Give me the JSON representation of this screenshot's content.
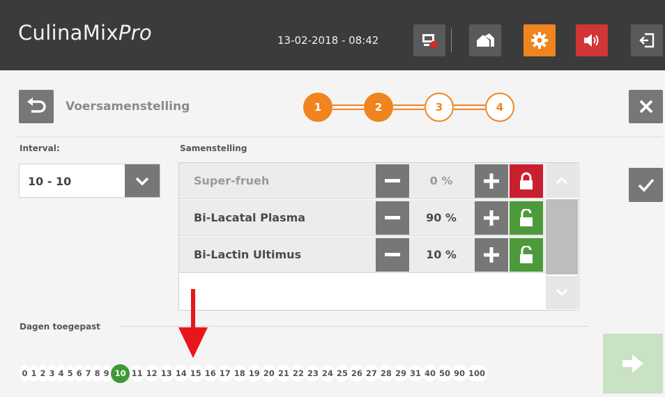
{
  "header": {
    "brand_main": "CulinaMix",
    "brand_italic": "Pro",
    "datetime": "13-02-2018 - 08:42",
    "buttons": [
      {
        "name": "display-icon",
        "color": "#5a5a5a"
      },
      {
        "name": "home-icon",
        "color": "#5a5a5a"
      },
      {
        "name": "gear-icon",
        "color": "#f0841e"
      },
      {
        "name": "speaker-icon",
        "color": "#d23535"
      },
      {
        "name": "logout-icon",
        "color": "#5a5a5a"
      }
    ]
  },
  "page": {
    "title": "Voersamenstelling",
    "steps": [
      "1",
      "2",
      "3",
      "4"
    ],
    "current_step": 2
  },
  "interval": {
    "label": "Interval:",
    "value": "10 - 10"
  },
  "composition": {
    "label": "Samenstelling",
    "rows": [
      {
        "name": "Super-frueh",
        "percent": "0 %",
        "locked": true
      },
      {
        "name": "Bi-Lacatal Plasma",
        "percent": "90 %",
        "locked": false
      },
      {
        "name": "Bi-Lactin Ultimus",
        "percent": "10 %",
        "locked": false
      }
    ]
  },
  "days": {
    "label": "Dagen toegepast",
    "items": [
      "0",
      "1",
      "2",
      "3",
      "4",
      "5",
      "6",
      "7",
      "8",
      "9",
      "10",
      "11",
      "12",
      "13",
      "14",
      "15",
      "16",
      "17",
      "18",
      "19",
      "20",
      "21",
      "22",
      "23",
      "24",
      "25",
      "26",
      "27",
      "28",
      "29",
      "31",
      "40",
      "50",
      "90",
      "100"
    ],
    "selected": "10"
  },
  "colors": {
    "accent": "#f0841e",
    "lock_red": "#c8202f",
    "lock_green": "#4c9a3a",
    "selected_day": "#3c9a37",
    "annotation_arrow": "#e8161b"
  }
}
